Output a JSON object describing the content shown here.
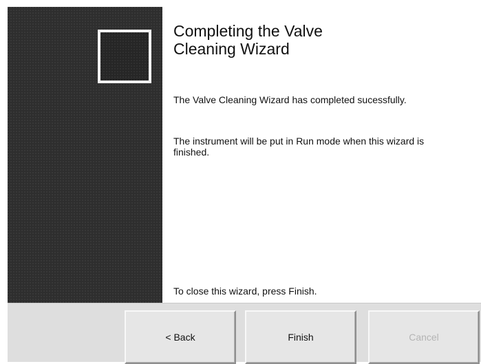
{
  "wizard": {
    "title": "Completing the Valve Cleaning Wizard",
    "paragraphs": {
      "completed": "The Valve Cleaning Wizard has completed sucessfully.",
      "run_mode": "The instrument will be put in Run mode when this wizard is finished."
    },
    "closing_instruction": "To close this wizard, press Finish."
  },
  "buttons": {
    "back_label": "< Back",
    "finish_label": "Finish",
    "cancel_label": "Cancel",
    "cancel_enabled": false
  },
  "side_panel": {
    "image_icon": "wizard-image-icon"
  },
  "colors": {
    "side_panel": "#2e2e2e",
    "button_bar": "#dedede",
    "disabled_text": "#b4b4b4"
  }
}
